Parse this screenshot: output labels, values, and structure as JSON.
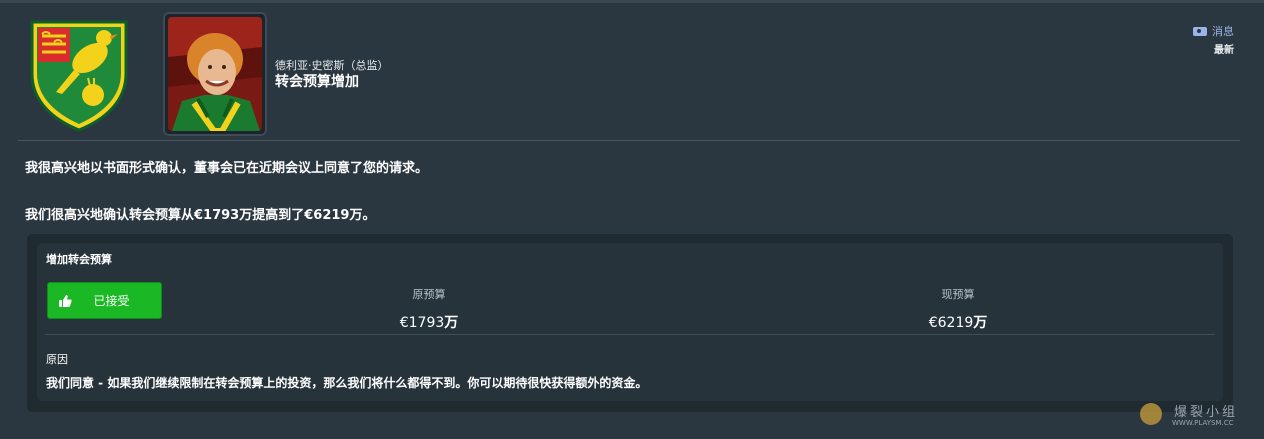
{
  "header": {
    "sender": "德利亚·史密斯（总监）",
    "subject": "转会预算增加"
  },
  "tag": {
    "type": "消息",
    "sub": "最新"
  },
  "body": {
    "paragraph1": "我很高兴地以书面形式确认，董事会已在近期会议上同意了您的请求。",
    "paragraph2": "我们很高兴地确认转会预算从€1793万提高到了€6219万。"
  },
  "panel": {
    "title": "增加转会预算",
    "status_button": "已接受",
    "old_budget_label": "原预算",
    "old_budget_amount": "€1793",
    "old_budget_unit": "万",
    "new_budget_label": "现预算",
    "new_budget_amount": "€6219",
    "new_budget_unit": "万",
    "reason_label": "原因",
    "reason_text": "我们同意 - 如果我们继续限制在转会预算上的投资，那么我们将什么都得不到。你可以期待很快获得额外的资金。"
  },
  "watermark": {
    "text": "爆裂小组",
    "url": "WWW.PLAYSM.CC"
  },
  "colors": {
    "background": "#2b3740",
    "panel": "#26333b",
    "accept_green": "#19b824",
    "tag_blue": "#9ab6e8",
    "club_yellow": "#f2d21b",
    "club_green": "#1f8a3a"
  },
  "icons": {
    "tag": "tag-icon",
    "accept": "thumbs-up-icon"
  }
}
